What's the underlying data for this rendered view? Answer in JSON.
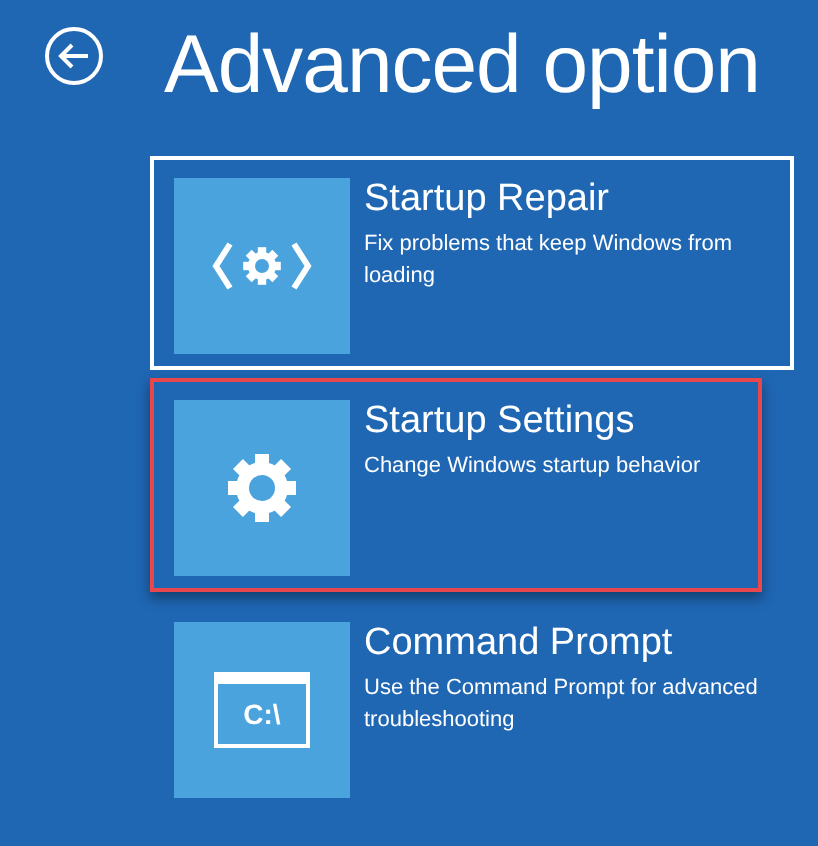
{
  "header": {
    "title": "Advanced option"
  },
  "options": [
    {
      "kind": "repair",
      "title": "Startup Repair",
      "description": "Fix problems that keep Windows from loading",
      "focused": true,
      "highlighted": false
    },
    {
      "kind": "settings",
      "title": "Startup Settings",
      "description": "Change Windows startup behavior",
      "focused": false,
      "highlighted": true
    },
    {
      "kind": "command",
      "title": "Command Prompt",
      "description": "Use the Command Prompt for advanced troubleshooting",
      "icon_text": "C:\\",
      "focused": false,
      "highlighted": false
    }
  ]
}
